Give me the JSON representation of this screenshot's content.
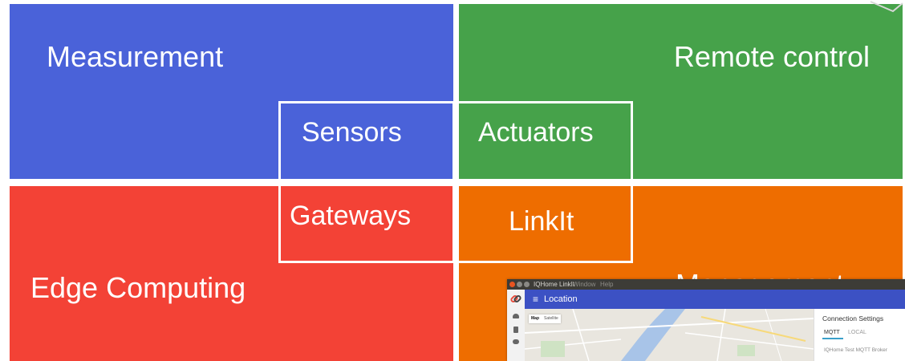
{
  "quadrants": {
    "top_left": "Measurement",
    "top_right": "Remote control",
    "bottom_left": "Edge Computing",
    "bottom_right": "Management"
  },
  "inner": {
    "top_left": "Sensors",
    "top_right": "Actuators",
    "bottom_left": "Gateways",
    "bottom_right": "LinkIt"
  },
  "colors": {
    "blue": "#4a62d9",
    "green": "#46a24a",
    "red": "#f34236",
    "orange": "#ee6d00"
  },
  "app": {
    "window_title": "IQHome LinkIt",
    "menu": [
      "Window",
      "Help"
    ],
    "appbar_title": "Location",
    "map_toggle": [
      "Map",
      "Satellite"
    ],
    "panel_title": "Connection Settings",
    "tabs": [
      "MQTT",
      "LOCAL"
    ],
    "field_label": "IQHome Test MQTT Broker",
    "icons": [
      "link-logo-icon",
      "menu-icon",
      "gauge-icon",
      "document-icon",
      "chat-icon"
    ]
  }
}
